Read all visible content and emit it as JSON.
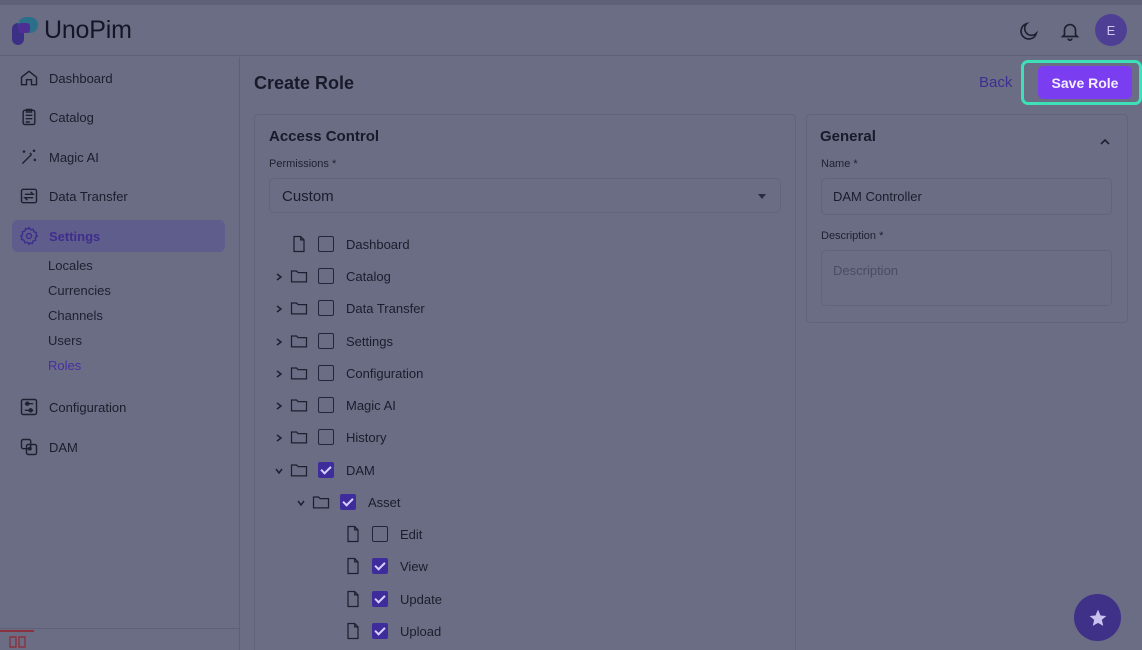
{
  "app": {
    "name": "UnoPim",
    "avatar_initial": "E"
  },
  "header": {
    "icons": [
      "moon-icon",
      "bell-icon"
    ]
  },
  "sidebar": {
    "items": [
      {
        "label": "Dashboard",
        "icon": "home-icon"
      },
      {
        "label": "Catalog",
        "icon": "clipboard-icon"
      },
      {
        "label": "Magic AI",
        "icon": "magic-wand-icon"
      },
      {
        "label": "Data Transfer",
        "icon": "transfer-icon"
      },
      {
        "label": "Settings",
        "icon": "gear-icon",
        "active": true
      },
      {
        "label": "Configuration",
        "icon": "sliders-icon"
      },
      {
        "label": "DAM",
        "icon": "dam-icon"
      }
    ],
    "settings_sub": [
      "Locales",
      "Currencies",
      "Channels",
      "Users",
      "Roles"
    ],
    "active_sub": "Roles"
  },
  "page": {
    "title": "Create Role",
    "back_label": "Back",
    "save_label": "Save Role"
  },
  "access_control": {
    "title": "Access Control",
    "permissions_label": "Permissions *",
    "permissions_value": "Custom",
    "tree": [
      {
        "label": "Dashboard",
        "checked": false
      },
      {
        "label": "Catalog",
        "checked": false
      },
      {
        "label": "Data Transfer",
        "checked": false
      },
      {
        "label": "Settings",
        "checked": false
      },
      {
        "label": "Configuration",
        "checked": false
      },
      {
        "label": "Magic AI",
        "checked": false
      },
      {
        "label": "History",
        "checked": false
      },
      {
        "label": "DAM",
        "checked": true
      },
      {
        "label": "Asset",
        "checked": true
      },
      {
        "label": "Edit",
        "checked": false
      },
      {
        "label": "View",
        "checked": true
      },
      {
        "label": "Update",
        "checked": true
      },
      {
        "label": "Upload",
        "checked": true
      }
    ]
  },
  "general": {
    "title": "General",
    "name_label": "Name *",
    "name_value": "DAM Controller",
    "description_label": "Description *",
    "description_placeholder": "Description"
  },
  "colors": {
    "accent": "#7a3ef0",
    "highlight": "#3ee0b8",
    "active_link": "#4630a0"
  }
}
